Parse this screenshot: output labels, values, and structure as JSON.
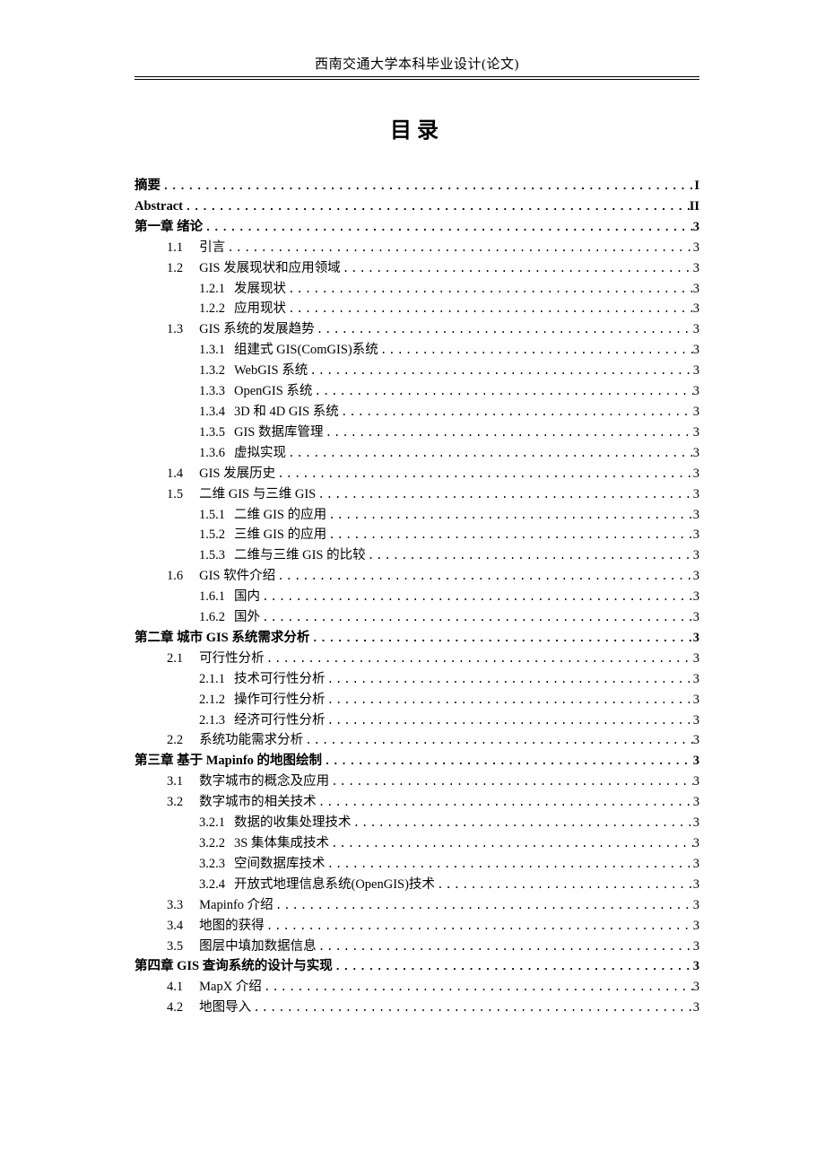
{
  "header": "西南交通大学本科毕业设计(论文)",
  "title": "目录",
  "toc": [
    {
      "level": 1,
      "bold": true,
      "label": "摘要",
      "page": "I"
    },
    {
      "level": 1,
      "bold": true,
      "label": "Abstract",
      "page": "II"
    },
    {
      "level": 1,
      "bold": true,
      "label": "第一章 绪论",
      "page": "3"
    },
    {
      "level": 2,
      "bold": false,
      "num": "1.1",
      "label": "引言",
      "page": "3"
    },
    {
      "level": 2,
      "bold": false,
      "num": "1.2",
      "label": "GIS 发展现状和应用领域 ",
      "page": "3"
    },
    {
      "level": 3,
      "bold": false,
      "num": "1.2.1",
      "label": "发展现状",
      "page": "3"
    },
    {
      "level": 3,
      "bold": false,
      "num": "1.2.2",
      "label": "应用现状",
      "page": "3"
    },
    {
      "level": 2,
      "bold": false,
      "num": "1.3",
      "label": "GIS 系统的发展趋势 ",
      "page": "3"
    },
    {
      "level": 3,
      "bold": false,
      "num": "1.3.1",
      "label": "组建式 GIS(ComGIS)系统 ",
      "page": "3"
    },
    {
      "level": 3,
      "bold": false,
      "num": "1.3.2",
      "label": "WebGIS 系统 ",
      "page": "3"
    },
    {
      "level": 3,
      "bold": false,
      "num": "1.3.3",
      "label": "OpenGIS 系统 ",
      "page": "3"
    },
    {
      "level": 3,
      "bold": false,
      "num": "1.3.4",
      "label": "3D 和 4D GIS 系统 ",
      "page": "3"
    },
    {
      "level": 3,
      "bold": false,
      "num": "1.3.5",
      "label": "GIS 数据库管理 ",
      "page": "3"
    },
    {
      "level": 3,
      "bold": false,
      "num": "1.3.6",
      "label": "虚拟实现",
      "page": "3"
    },
    {
      "level": 2,
      "bold": false,
      "num": "1.4",
      "label": "GIS 发展历史 ",
      "page": "3"
    },
    {
      "level": 2,
      "bold": false,
      "num": "1.5",
      "label": "二维 GIS 与三维 GIS ",
      "page": "3"
    },
    {
      "level": 3,
      "bold": false,
      "num": "1.5.1",
      "label": "二维 GIS 的应用",
      "page": "3"
    },
    {
      "level": 3,
      "bold": false,
      "num": "1.5.2",
      "label": "三维 GIS 的应用",
      "page": "3"
    },
    {
      "level": 3,
      "bold": false,
      "num": "1.5.3",
      "label": "二维与三维 GIS 的比较",
      "page": "3"
    },
    {
      "level": 2,
      "bold": false,
      "num": "1.6",
      "label": "GIS 软件介绍 ",
      "page": "3"
    },
    {
      "level": 3,
      "bold": false,
      "num": "1.6.1",
      "label": "国内",
      "page": "3"
    },
    {
      "level": 3,
      "bold": false,
      "num": "1.6.2",
      "label": "国外",
      "page": "3"
    },
    {
      "level": 1,
      "bold": true,
      "label": "第二章 城市 GIS 系统需求分析",
      "page": "3"
    },
    {
      "level": 2,
      "bold": false,
      "num": "2.1",
      "label": "可行性分析",
      "page": "3"
    },
    {
      "level": 3,
      "bold": false,
      "num": "2.1.1",
      "label": "技术可行性分析",
      "page": "3"
    },
    {
      "level": 3,
      "bold": false,
      "num": "2.1.2",
      "label": "操作可行性分析",
      "page": "3"
    },
    {
      "level": 3,
      "bold": false,
      "num": "2.1.3",
      "label": "经济可行性分析",
      "page": "3"
    },
    {
      "level": 2,
      "bold": false,
      "num": "2.2",
      "label": "系统功能需求分析",
      "page": "3"
    },
    {
      "level": 1,
      "bold": true,
      "label": "第三章 基于 Mapinfo 的地图绘制",
      "page": "3"
    },
    {
      "level": 2,
      "bold": false,
      "num": "3.1",
      "label": "数字城市的概念及应用",
      "page": "3"
    },
    {
      "level": 2,
      "bold": false,
      "num": "3.2",
      "label": "数字城市的相关技术",
      "page": "3"
    },
    {
      "level": 3,
      "bold": false,
      "num": "3.2.1",
      "label": "数据的收集处理技术",
      "page": "3"
    },
    {
      "level": 3,
      "bold": false,
      "num": "3.2.2",
      "label": "3S 集体集成技术 ",
      "page": "3"
    },
    {
      "level": 3,
      "bold": false,
      "num": "3.2.3",
      "label": "空间数据库技术",
      "page": "3"
    },
    {
      "level": 3,
      "bold": false,
      "num": "3.2.4",
      "label": "开放式地理信息系统(OpenGIS)技术",
      "page": "3"
    },
    {
      "level": 2,
      "bold": false,
      "num": "3.3",
      "label": "Mapinfo 介绍 ",
      "page": "3"
    },
    {
      "level": 2,
      "bold": false,
      "num": "3.4",
      "label": "地图的获得",
      "page": "3"
    },
    {
      "level": 2,
      "bold": false,
      "num": "3.5",
      "label": "图层中填加数据信息",
      "page": "3"
    },
    {
      "level": 1,
      "bold": true,
      "label": "第四章 GIS 查询系统的设计与实现",
      "page": "3"
    },
    {
      "level": 2,
      "bold": false,
      "num": "4.1",
      "label": "MapX 介绍 ",
      "page": "3"
    },
    {
      "level": 2,
      "bold": false,
      "num": "4.2",
      "label": "地图导入",
      "page": "3"
    }
  ]
}
